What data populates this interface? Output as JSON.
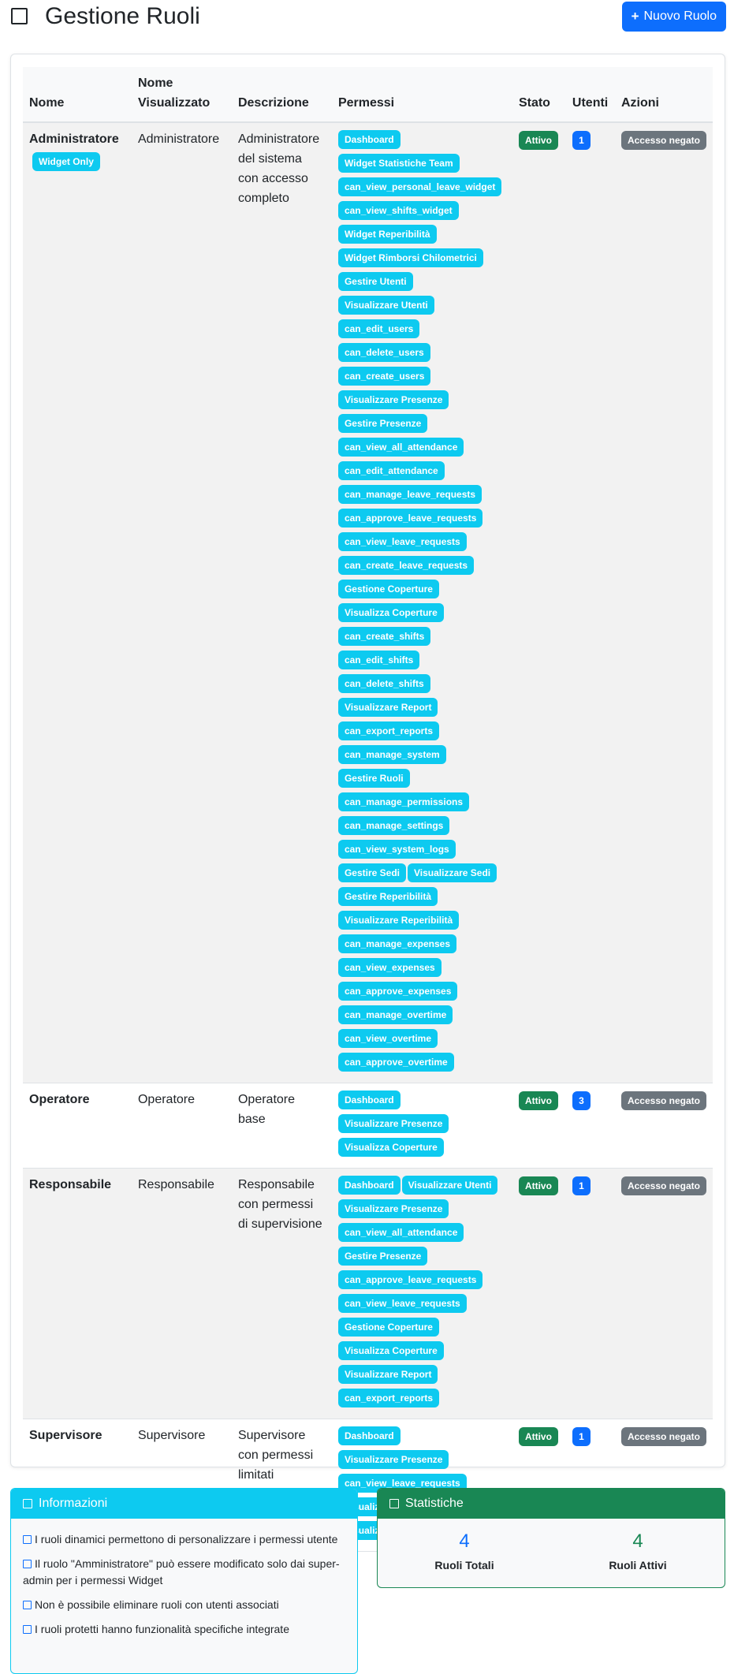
{
  "header": {
    "title": "Gestione Ruoli",
    "new_button": "Nuovo Ruolo"
  },
  "table": {
    "columns": [
      "Nome",
      "Nome Visualizzato",
      "Descrizione",
      "Permessi",
      "Stato",
      "Utenti",
      "Azioni"
    ],
    "rows": [
      {
        "name": "Administratore",
        "tag": "Widget Only",
        "display_name": "Administratore",
        "description": "Administratore del sistema con accesso completo",
        "permissions": [
          "Dashboard",
          "Widget Statistiche Team",
          "can_view_personal_leave_widget",
          "can_view_shifts_widget",
          "Widget Reperibilità",
          "Widget Rimborsi Chilometrici",
          "Gestire Utenti",
          "Visualizzare Utenti",
          "can_edit_users",
          "can_delete_users",
          "can_create_users",
          "Visualizzare Presenze",
          "Gestire Presenze",
          "can_view_all_attendance",
          "can_edit_attendance",
          "can_manage_leave_requests",
          "can_approve_leave_requests",
          "can_view_leave_requests",
          "can_create_leave_requests",
          "Gestione Coperture",
          "Visualizza Coperture",
          "can_create_shifts",
          "can_edit_shifts",
          "can_delete_shifts",
          "Visualizzare Report",
          "can_export_reports",
          "can_manage_system",
          "Gestire Ruoli",
          "can_manage_permissions",
          "can_manage_settings",
          "can_view_system_logs",
          "Gestire Sedi",
          "Visualizzare Sedi",
          "Gestire Reperibilità",
          "Visualizzare Reperibilità",
          "can_manage_expenses",
          "can_view_expenses",
          "can_approve_expenses",
          "can_manage_overtime",
          "can_view_overtime",
          "can_approve_overtime"
        ],
        "status": "Attivo",
        "users": "1",
        "action": "Accesso negato"
      },
      {
        "name": "Operatore",
        "display_name": "Operatore",
        "description": "Operatore base",
        "permissions": [
          "Dashboard",
          "Visualizzare Presenze",
          "Visualizza Coperture"
        ],
        "status": "Attivo",
        "users": "3",
        "action": "Accesso negato"
      },
      {
        "name": "Responsabile",
        "display_name": "Responsabile",
        "description": "Responsabile con permessi di supervisione",
        "permissions": [
          "Dashboard",
          "Visualizzare Utenti",
          "Visualizzare Presenze",
          "can_view_all_attendance",
          "Gestire Presenze",
          "can_approve_leave_requests",
          "can_view_leave_requests",
          "Gestione Coperture",
          "Visualizza Coperture",
          "Visualizzare Report",
          "can_export_reports"
        ],
        "status": "Attivo",
        "users": "1",
        "action": "Accesso negato"
      },
      {
        "name": "Supervisore",
        "display_name": "Supervisore",
        "description": "Supervisore con permessi limitati",
        "permissions": [
          "Dashboard",
          "Visualizzare Presenze",
          "can_view_leave_requests",
          "Visualizza Coperture",
          "Visualizzare Report"
        ],
        "status": "Attivo",
        "users": "1",
        "action": "Accesso negato"
      }
    ]
  },
  "info": {
    "title": "Informazioni",
    "items": [
      "I ruoli dinamici permettono di personalizzare i permessi utente",
      "Il ruolo \"Amministratore\" può essere modificato solo dai super-admin per i permessi Widget",
      "Non è possibile eliminare ruoli con utenti associati",
      "I ruoli protetti hanno funzionalità specifiche integrate"
    ]
  },
  "stats": {
    "title": "Statistiche",
    "total_value": "4",
    "total_label": "Ruoli Totali",
    "active_value": "4",
    "active_label": "Ruoli Attivi"
  },
  "colors": {
    "primary": "#0d6efd",
    "info": "#0dcaf0",
    "success": "#198754",
    "secondary": "#6c757d"
  }
}
